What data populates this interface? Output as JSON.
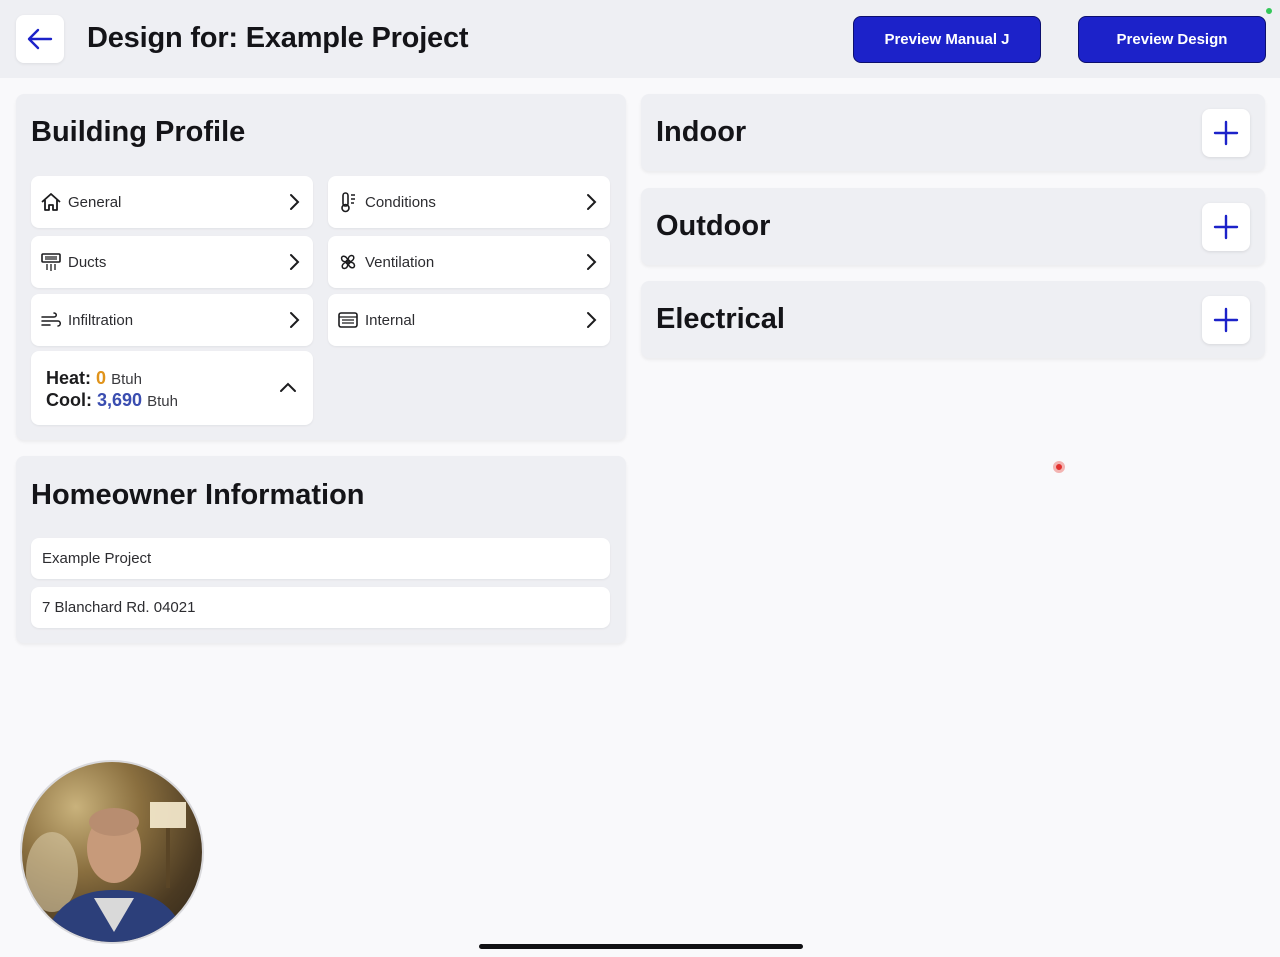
{
  "header": {
    "title": "Design for: Example Project",
    "back_icon": "arrow-left-icon",
    "preview_manual_j_label": "Preview Manual J",
    "preview_design_label": "Preview Design",
    "accent_color": "#1c22c9"
  },
  "building_profile": {
    "title": "Building Profile",
    "items": [
      {
        "label": "General",
        "icon": "house-icon"
      },
      {
        "label": "Conditions",
        "icon": "thermometer-icon"
      },
      {
        "label": "Ducts",
        "icon": "duct-vent-icon"
      },
      {
        "label": "Ventilation",
        "icon": "fan-icon"
      },
      {
        "label": "Infiltration",
        "icon": "wind-icon"
      },
      {
        "label": "Internal",
        "icon": "appliance-icon"
      }
    ],
    "summary": {
      "heat_label": "Heat:",
      "heat_value": "0",
      "heat_unit": "Btuh",
      "cool_label": "Cool:",
      "cool_value": "3,690",
      "cool_unit": "Btuh",
      "heat_color": "#e0931a",
      "cool_color": "#3a4db0"
    }
  },
  "homeowner": {
    "title": "Homeowner Information",
    "name": "Example Project",
    "address": "7 Blanchard Rd. 04021"
  },
  "sections": [
    {
      "title": "Indoor",
      "icon": "plus-icon"
    },
    {
      "title": "Outdoor",
      "icon": "plus-icon"
    },
    {
      "title": "Electrical",
      "icon": "plus-icon"
    }
  ]
}
